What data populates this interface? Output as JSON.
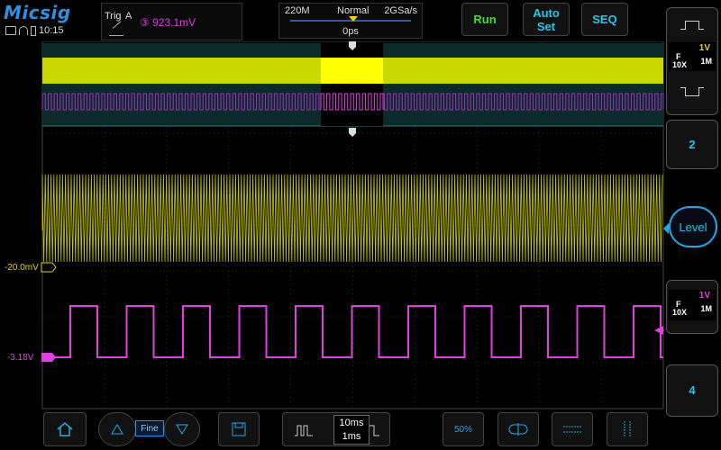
{
  "app": {
    "brand": "Micsig",
    "clock": "10:15"
  },
  "trigger": {
    "label": "Trig",
    "source": "A",
    "level": "③ 923.1mV"
  },
  "timebase": {
    "memory_depth": "220M",
    "mode": "Normal",
    "sample_rate": "2GSa/s",
    "position": "0ps"
  },
  "top_buttons": {
    "run": "Run",
    "auto_line1": "Auto",
    "auto_line2": "Set",
    "seq": "SEQ"
  },
  "channels": {
    "ch1": {
      "scale": "1V",
      "coupling": "F",
      "probe": "10X",
      "impedance": "1M",
      "offset_label": "-20.0mV",
      "color": "#e8d800"
    },
    "ch2": {
      "label": "2"
    },
    "ch3": {
      "scale": "1V",
      "coupling": "F",
      "probe": "10X",
      "impedance": "1M",
      "offset_label": "-3.18V",
      "color": "#e040e0"
    },
    "ch4": {
      "label": "4"
    }
  },
  "level_button": "Level",
  "bottom": {
    "fine": "Fine",
    "time_div": "10ms",
    "time_div2": "1ms",
    "fifty": "50%"
  },
  "colors": {
    "accent": "#22c8e8",
    "run": "#3ae03a",
    "ch1": "#e8d800",
    "ch3": "#e040e0"
  }
}
